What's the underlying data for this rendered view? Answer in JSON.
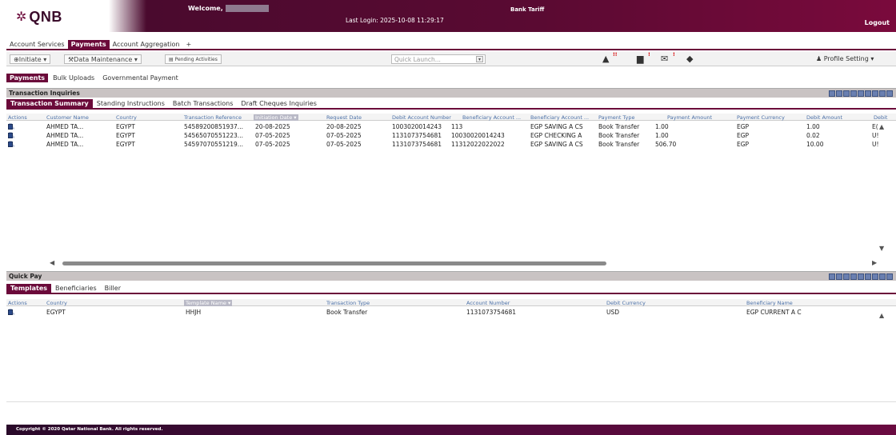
{
  "header": {
    "brand": "QNB",
    "welcome": "Welcome,",
    "last_login": "Last Login: 2025-10-08 11:29:17",
    "bank_tariff": "Bank Tariff",
    "logout": "Logout"
  },
  "top_tabs": [
    "Account Services",
    "Payments",
    "Account Aggregation",
    "+"
  ],
  "toolbar": {
    "initiate": "Initiate",
    "data_maintenance": "Data Maintenance",
    "pending": "Pending Activities",
    "quick_launch_placeholder": "Quick Launch...",
    "profile": "Profile Setting"
  },
  "sub_tabs": [
    "Payments",
    "Bulk Uploads",
    "Governmental Payment"
  ],
  "inquiries": {
    "title": "Transaction Inquiries",
    "tabs": [
      "Transaction Summary",
      "Standing Instructions",
      "Batch Transactions",
      "Draft Cheques Inquiries"
    ],
    "columns": [
      "Actions",
      "Customer Name",
      "Country",
      "Transaction Reference",
      "Initiation Date",
      "Request Date",
      "Debit Account Number",
      "Beneficiary Account ...",
      "Beneficiary Account ...",
      "Payment Type",
      "Payment Amount",
      "Payment Currency",
      "Debit Amount",
      "Debit"
    ],
    "rows": [
      [
        "AHMED TA...",
        "EGYPT",
        "54589200851937...",
        "20-08-2025",
        "20-08-2025",
        "1003020014243",
        "113",
        "EGP SAVING A CS",
        "Book Transfer",
        "1.00",
        "EGP",
        "1.00",
        "E("
      ],
      [
        "AHMED TA...",
        "EGYPT",
        "54565070551223...",
        "07-05-2025",
        "07-05-2025",
        "1131073754681",
        "10030020014243",
        "EGP CHECKING A",
        "Book Transfer",
        "1.00",
        "EGP",
        "0.02",
        "U!"
      ],
      [
        "AHMED TA...",
        "EGYPT",
        "54597070551219...",
        "07-05-2025",
        "07-05-2025",
        "1131073754681",
        "11312022022022",
        "EGP SAVING A CS",
        "Book Transfer",
        "506.70",
        "EGP",
        "10.00",
        "U!"
      ]
    ]
  },
  "quick_pay": {
    "title": "Quick Pay",
    "tabs": [
      "Templates",
      "Beneficiaries",
      "Biller"
    ],
    "columns": [
      "Actions",
      "Country",
      "Template Name",
      "Transaction Type",
      "Account Number",
      "Debit Currency",
      "Beneficiary Name"
    ],
    "rows": [
      [
        "EGYPT",
        "HHJH",
        "Book Transfer",
        "1131073754681",
        "USD",
        "EGP CURRENT A C"
      ]
    ]
  },
  "footer": "Copyright © 2020 Qatar National Bank. All rights reserved."
}
